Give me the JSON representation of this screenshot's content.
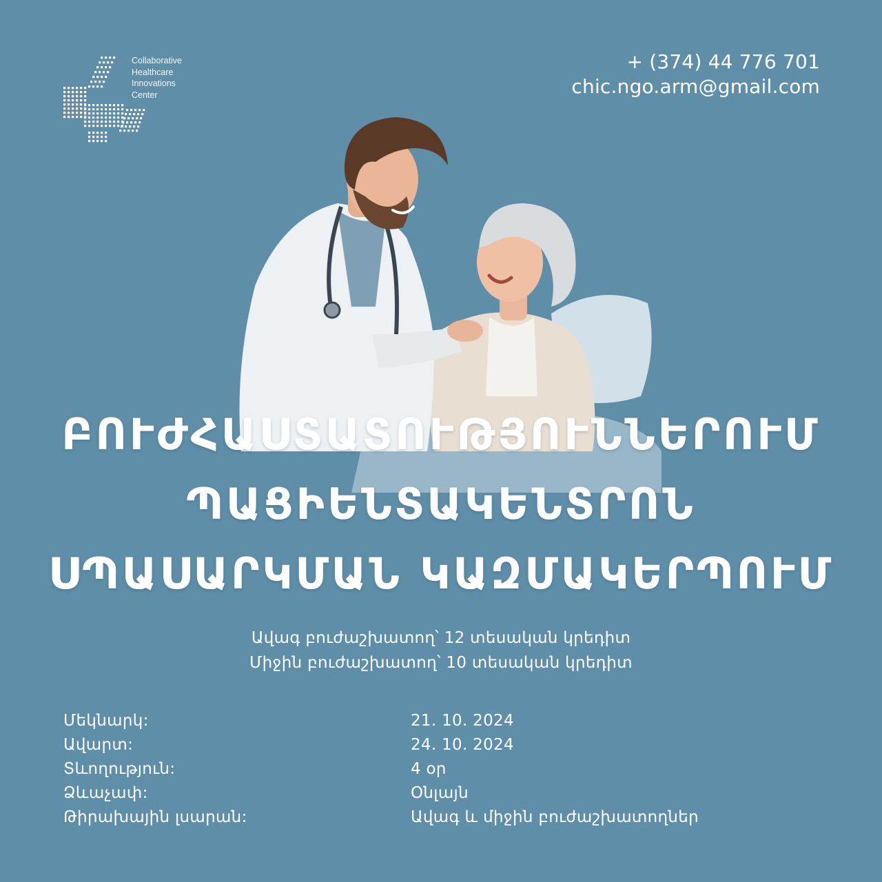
{
  "brand": {
    "logo_lines": [
      "Collaborative",
      "Healthcare",
      "Innovations",
      "Center"
    ]
  },
  "contact": {
    "phone": "+ (374) 44 776 701",
    "email": "chic.ngo.arm@gmail.com"
  },
  "headline": {
    "line1": "ԲՈՒԺՀԱՍՏԱՏՈՒԹՅՈՒՆՆԵՐՈՒՄ",
    "line2": "ՊԱՑԻԵՆՏԱԿԵՆՏՐՈՆ",
    "line3": "ՍՊԱՍԱՐԿՄԱՆ ԿԱԶՄԱԿԵՐՊՈՒՄ"
  },
  "credits": {
    "senior": "Ավագ բուժաշխատող՝  12 տեսական կրեդիտ",
    "middle": "Միջին բուժաշխատող՝  10 տեսական կրեդիտ"
  },
  "details": [
    {
      "label": "Մեկնարկ:",
      "value": "21. 10. 2024"
    },
    {
      "label": "Ավարտ:",
      "value": "24. 10. 2024"
    },
    {
      "label": "Տևողություն:",
      "value": "4 օր"
    },
    {
      "label": "Ձևաչափ:",
      "value": "Օնլայն"
    },
    {
      "label": "Թիրախային լսարան:",
      "value": "Ավագ և միջին բուժաշխատողներ"
    }
  ],
  "colors": {
    "background": "#5f8ea8",
    "text": "#ffffff",
    "coat": "#eef1f3",
    "hair_man": "#5a3a26",
    "hair_woman": "#d9dcde"
  }
}
